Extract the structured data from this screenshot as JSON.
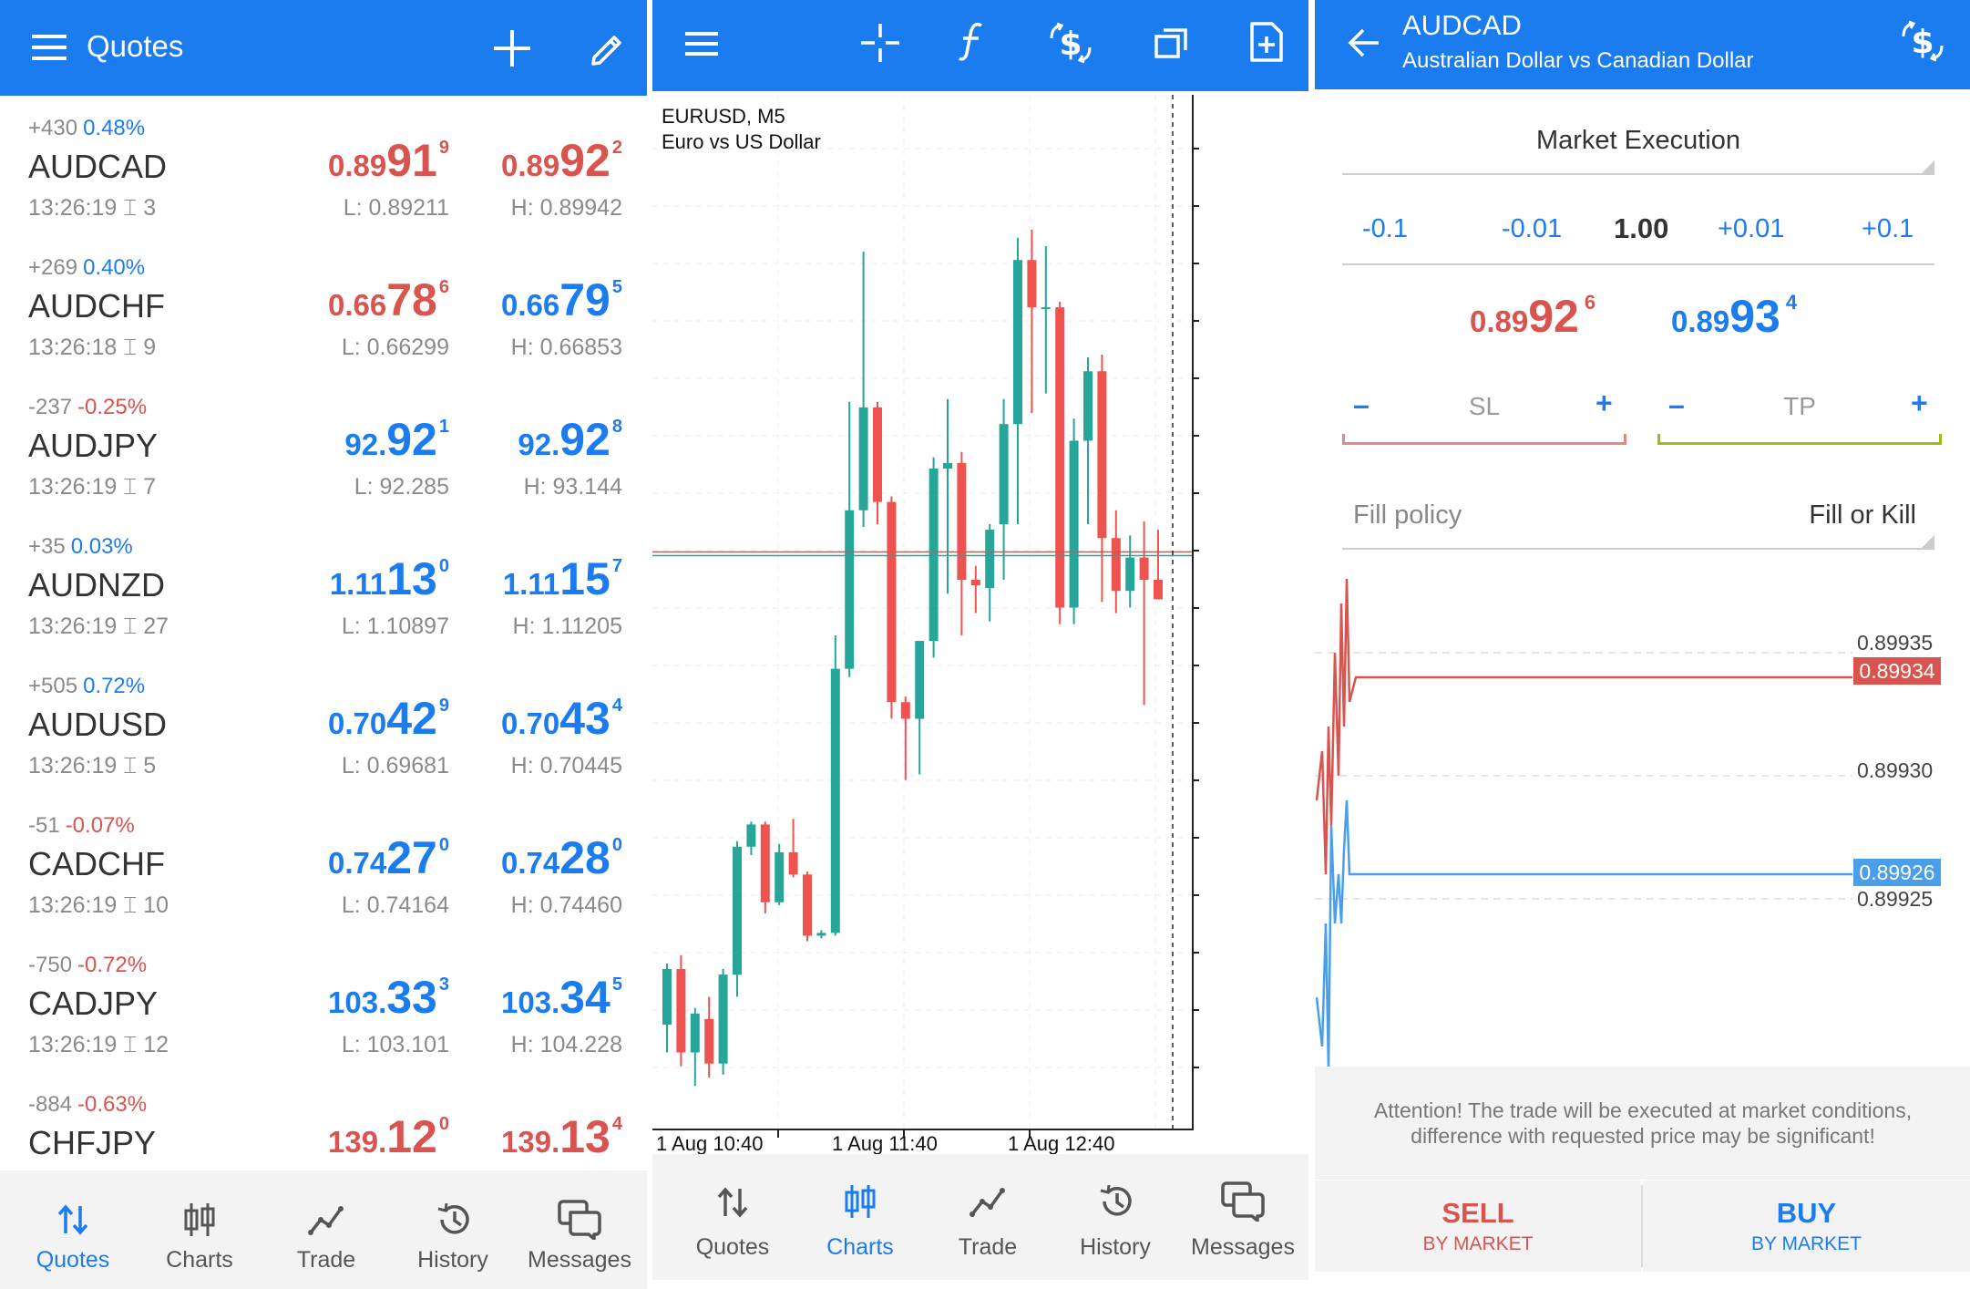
{
  "quotes": {
    "title": "Quotes",
    "items": [
      {
        "change": "+430",
        "pct": "0.48%",
        "pct_color": "blue",
        "symbol": "AUDCAD",
        "time": "13:26:19",
        "spread": "3",
        "bid": {
          "a": "0.89",
          "b": "91",
          "c": "9",
          "color": "red"
        },
        "ask": {
          "a": "0.89",
          "b": "92",
          "c": "2",
          "color": "red"
        },
        "low": "L: 0.89211",
        "high": "H: 0.89942"
      },
      {
        "change": "+269",
        "pct": "0.40%",
        "pct_color": "blue",
        "symbol": "AUDCHF",
        "time": "13:26:18",
        "spread": "9",
        "bid": {
          "a": "0.66",
          "b": "78",
          "c": "6",
          "color": "red"
        },
        "ask": {
          "a": "0.66",
          "b": "79",
          "c": "5",
          "color": "blue"
        },
        "low": "L: 0.66299",
        "high": "H: 0.66853"
      },
      {
        "change": "-237",
        "pct": "-0.25%",
        "pct_color": "red",
        "symbol": "AUDJPY",
        "time": "13:26:19",
        "spread": "7",
        "bid": {
          "a": "92.",
          "b": "92",
          "c": "1",
          "color": "blue"
        },
        "ask": {
          "a": "92.",
          "b": "92",
          "c": "8",
          "color": "blue"
        },
        "low": "L: 92.285",
        "high": "H: 93.144"
      },
      {
        "change": "+35",
        "pct": "0.03%",
        "pct_color": "blue",
        "symbol": "AUDNZD",
        "time": "13:26:19",
        "spread": "27",
        "bid": {
          "a": "1.11",
          "b": "13",
          "c": "0",
          "color": "blue"
        },
        "ask": {
          "a": "1.11",
          "b": "15",
          "c": "7",
          "color": "blue"
        },
        "low": "L: 1.10897",
        "high": "H: 1.11205"
      },
      {
        "change": "+505",
        "pct": "0.72%",
        "pct_color": "blue",
        "symbol": "AUDUSD",
        "time": "13:26:19",
        "spread": "5",
        "bid": {
          "a": "0.70",
          "b": "42",
          "c": "9",
          "color": "blue"
        },
        "ask": {
          "a": "0.70",
          "b": "43",
          "c": "4",
          "color": "blue"
        },
        "low": "L: 0.69681",
        "high": "H: 0.70445"
      },
      {
        "change": "-51",
        "pct": "-0.07%",
        "pct_color": "red",
        "symbol": "CADCHF",
        "time": "13:26:19",
        "spread": "10",
        "bid": {
          "a": "0.74",
          "b": "27",
          "c": "0",
          "color": "blue"
        },
        "ask": {
          "a": "0.74",
          "b": "28",
          "c": "0",
          "color": "blue"
        },
        "low": "L: 0.74164",
        "high": "H: 0.74460"
      },
      {
        "change": "-750",
        "pct": "-0.72%",
        "pct_color": "red",
        "symbol": "CADJPY",
        "time": "13:26:19",
        "spread": "12",
        "bid": {
          "a": "103.",
          "b": "33",
          "c": "3",
          "color": "blue"
        },
        "ask": {
          "a": "103.",
          "b": "34",
          "c": "5",
          "color": "blue"
        },
        "low": "L: 103.101",
        "high": "H: 104.228"
      },
      {
        "change": "-884",
        "pct": "-0.63%",
        "pct_color": "red",
        "symbol": "CHFJPY",
        "time": "",
        "spread": "",
        "bid": {
          "a": "139.",
          "b": "12",
          "c": "0",
          "color": "red"
        },
        "ask": {
          "a": "139.",
          "b": "13",
          "c": "4",
          "color": "red"
        },
        "low": "",
        "high": ""
      }
    ]
  },
  "nav": {
    "quotes": "Quotes",
    "charts": "Charts",
    "trade": "Trade",
    "history": "History",
    "messages": "Messages"
  },
  "chart": {
    "symbol_line": "EURUSD, M5",
    "desc_line": "Euro vs US Dollar",
    "x_labels": [
      "1 Aug 10:40",
      "1 Aug 11:40",
      "1 Aug 12:40"
    ],
    "candles": [
      [
        20,
        40,
        10,
        42
      ],
      [
        40,
        10,
        45,
        5
      ],
      [
        10,
        24,
        -2,
        26
      ],
      [
        22,
        6,
        1,
        30
      ],
      [
        6,
        38,
        2,
        40
      ],
      [
        38,
        84,
        30,
        86
      ],
      [
        84,
        92,
        81,
        93
      ],
      [
        92,
        64,
        60,
        93
      ],
      [
        64,
        82,
        63,
        85
      ],
      [
        82,
        74,
        73,
        94
      ],
      [
        74,
        52,
        50,
        75
      ],
      [
        52,
        53,
        51,
        54
      ],
      [
        53,
        148,
        52,
        160
      ],
      [
        148,
        205,
        145,
        244
      ],
      [
        205,
        242,
        199,
        298
      ],
      [
        242,
        208,
        200,
        244
      ],
      [
        208,
        136,
        130,
        210
      ],
      [
        136,
        130,
        108,
        138
      ],
      [
        130,
        158,
        110,
        158
      ],
      [
        158,
        220,
        152,
        224
      ],
      [
        220,
        222,
        175,
        245
      ],
      [
        222,
        180,
        160,
        226
      ],
      [
        180,
        178,
        168,
        185
      ],
      [
        177,
        198,
        165,
        200
      ],
      [
        200,
        236,
        180,
        245
      ],
      [
        236,
        295,
        200,
        303
      ],
      [
        295,
        278,
        240,
        306
      ],
      [
        278,
        278,
        247,
        300
      ],
      [
        278,
        170,
        164,
        280
      ],
      [
        170,
        230,
        164,
        238
      ],
      [
        230,
        255,
        200,
        260
      ],
      [
        255,
        195,
        172,
        261
      ],
      [
        195,
        176,
        168,
        205
      ],
      [
        176,
        188,
        170,
        196
      ],
      [
        188,
        180,
        135,
        201
      ],
      [
        180,
        173,
        176,
        198
      ]
    ],
    "last_price_line": 190
  },
  "order": {
    "symbol": "AUDCAD",
    "description": "Australian Dollar vs Canadian Dollar",
    "execution": "Market Execution",
    "volume": {
      "m01": "-0.1",
      "m001": "-0.01",
      "value": "1.00",
      "p001": "+0.01",
      "p01": "+0.1"
    },
    "bid": {
      "a": "0.89",
      "b": "92",
      "c": "6"
    },
    "ask": {
      "a": "0.89",
      "b": "93",
      "c": "4"
    },
    "sl": {
      "minus": "–",
      "label": "SL",
      "plus": "+"
    },
    "tp": {
      "minus": "–",
      "label": "TP",
      "plus": "+"
    },
    "fill_policy_label": "Fill policy",
    "fill_policy_value": "Fill or Kill",
    "tick_chart": {
      "y_labels": [
        "0.89935",
        "0.89930",
        "0.89925"
      ],
      "ask_tag": "0.89934",
      "bid_tag": "0.89926",
      "ask_series": [
        0.89929,
        0.89931,
        0.89926,
        0.89932,
        0.89928,
        0.89935,
        0.8993,
        0.89937,
        0.89932,
        0.89938,
        0.89933,
        0.89934,
        0.89934
      ],
      "bid_series": [
        0.89921,
        0.89919,
        0.89924,
        0.89918,
        0.89928,
        0.89924,
        0.89926,
        0.89924,
        0.89927,
        0.89929,
        0.89926,
        0.89926,
        0.89926
      ]
    },
    "notice": "Attention! The trade will be executed at market conditions, difference with requested price may be significant!",
    "sell": {
      "label": "SELL",
      "sub": "BY MARKET"
    },
    "buy": {
      "label": "BUY",
      "sub": "BY MARKET"
    },
    "colors": {
      "sell": "#d9534f",
      "buy": "#1b7cf0",
      "tp_line": "#9bbb1c"
    }
  },
  "colors": {
    "accent": "#1b7cf0",
    "bull": "#26a69a",
    "bear": "#ef5350"
  }
}
